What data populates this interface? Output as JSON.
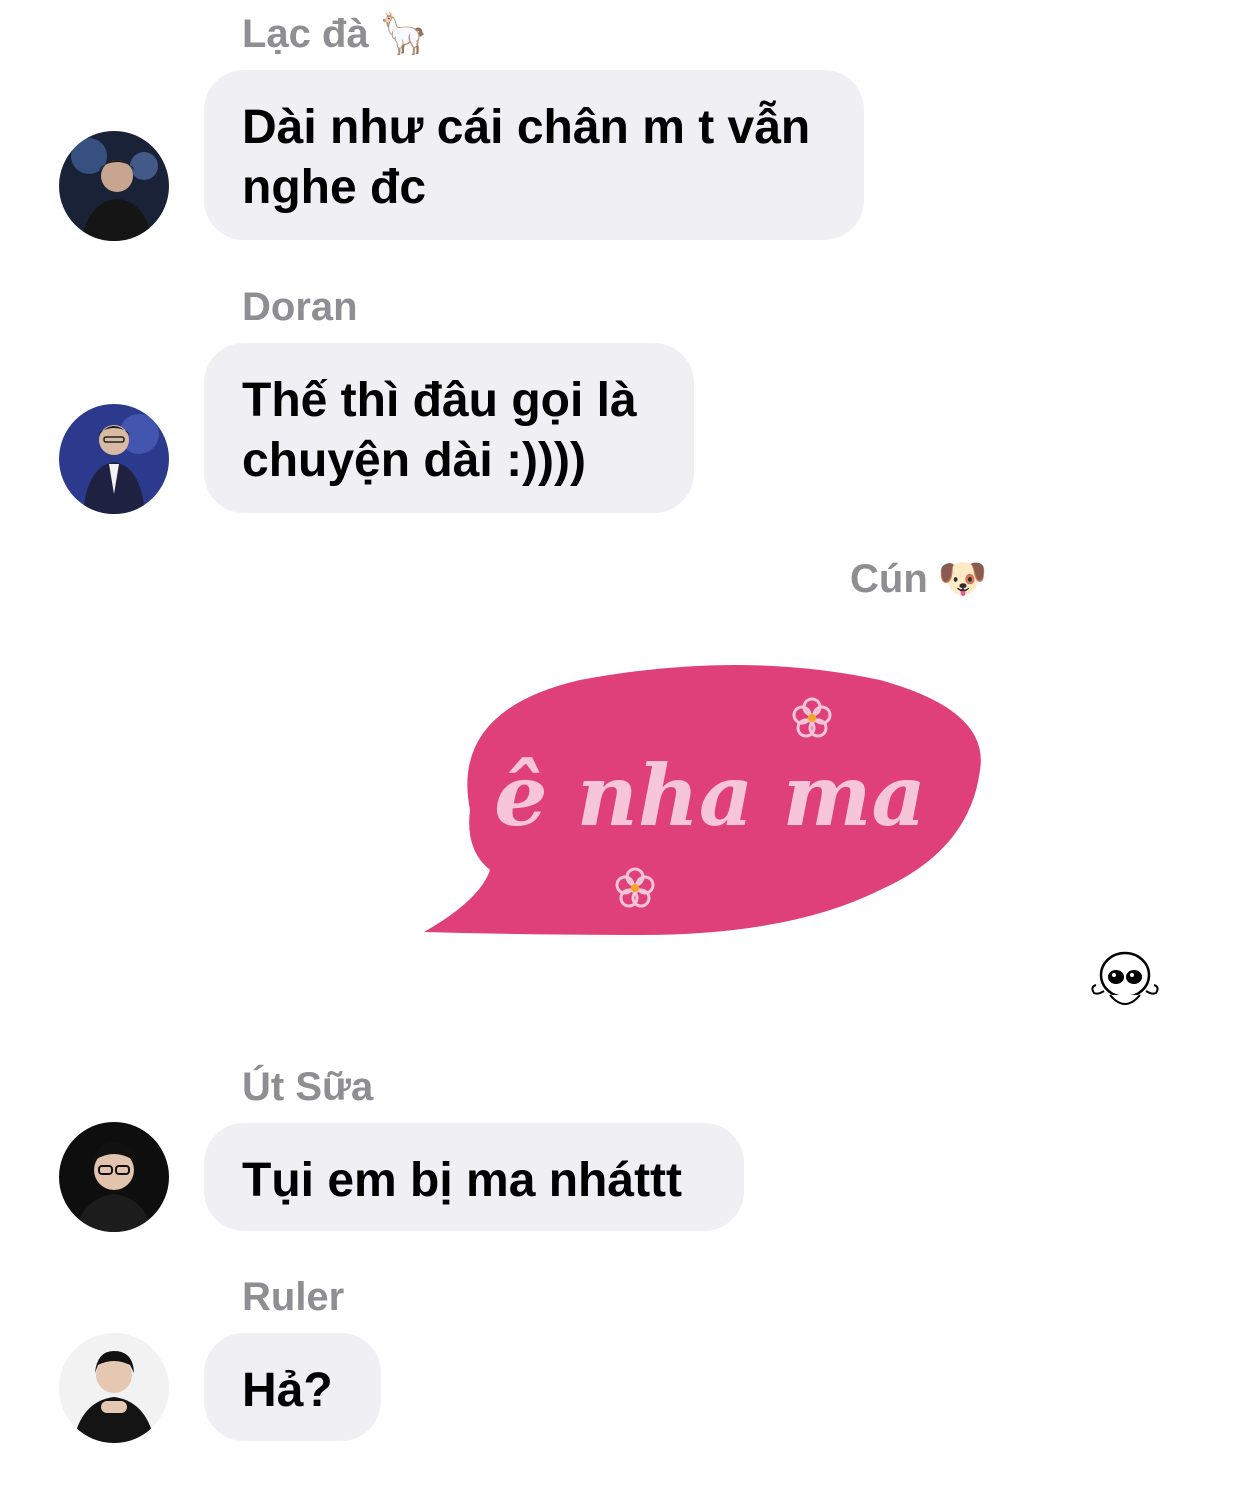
{
  "messages": [
    {
      "sender": "Lạc đà",
      "sender_emoji": "🦙",
      "text_lines": [
        "Dài như cái chân m t vẫn",
        "nghe đc"
      ]
    },
    {
      "sender": "Doran",
      "text_lines": [
        "Thế thì đâu gọi là",
        "chuyện dài :))))"
      ]
    },
    {
      "sender": "Cún",
      "sender_emoji": "🐶",
      "sticker_text": "ê nha ma",
      "sticker_color": "#e0407a"
    },
    {
      "sender": "Út Sữa",
      "text_lines": [
        "Tụi em bị ma nháttt"
      ]
    },
    {
      "sender": "Ruler",
      "text_lines": [
        "Hả?"
      ]
    }
  ],
  "colors": {
    "bubble": "#efeff4",
    "sender_name": "#8e8e93",
    "text": "#000000"
  }
}
